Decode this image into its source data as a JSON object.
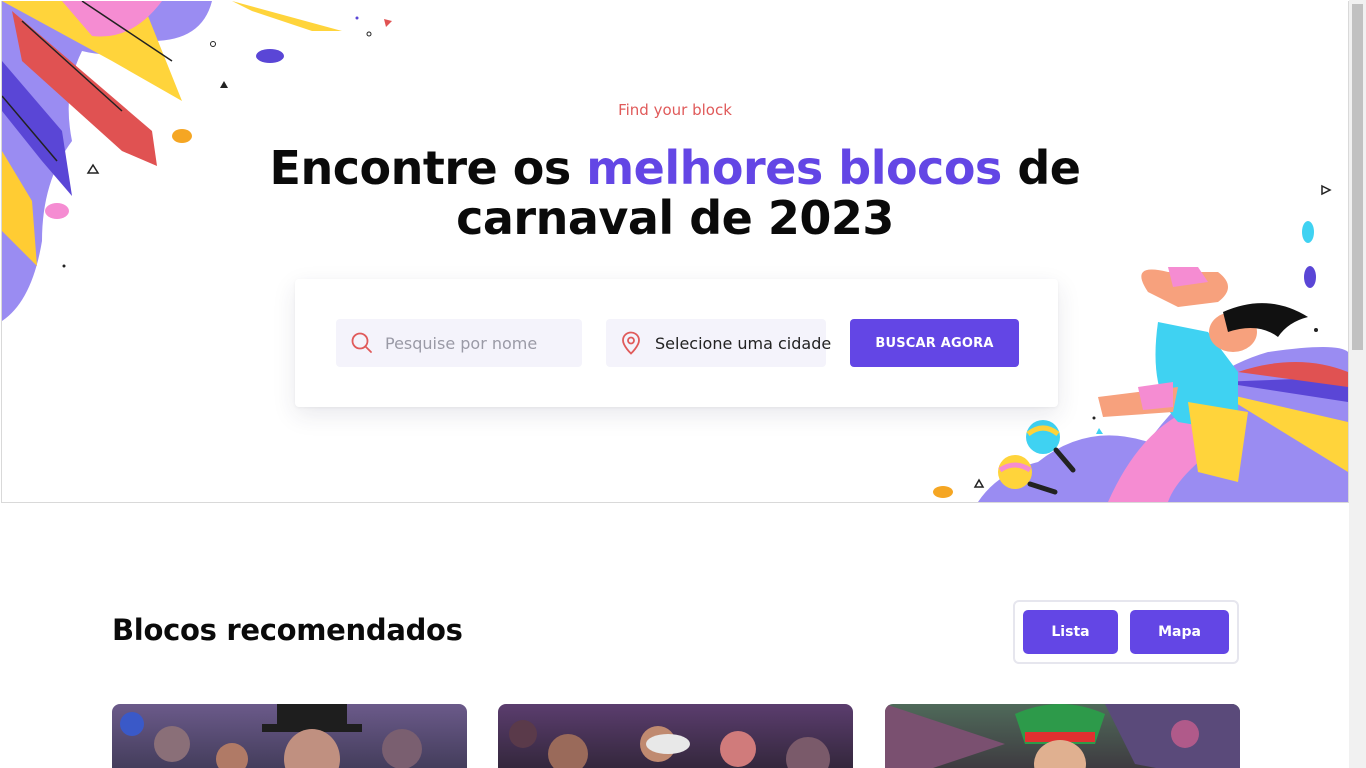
{
  "hero": {
    "eyebrow": "Find your block",
    "headline_part1": "Encontre os ",
    "headline_accent": "melhores blocos",
    "headline_part2": " de",
    "headline_line2": "carnaval de 2023"
  },
  "search": {
    "name_placeholder": "Pesquise por nome",
    "city_label": "Selecione uma cidade",
    "button_label": "BUSCAR AGORA",
    "search_icon": "search-icon",
    "city_icon": "map-pin-icon"
  },
  "recommended": {
    "title": "Blocos recomendados",
    "view_toggle": {
      "list_label": "Lista",
      "map_label": "Mapa"
    }
  },
  "colors": {
    "accent": "#6346e5",
    "eyebrow": "#e05a5a",
    "field_bg": "#f4f3fb"
  }
}
